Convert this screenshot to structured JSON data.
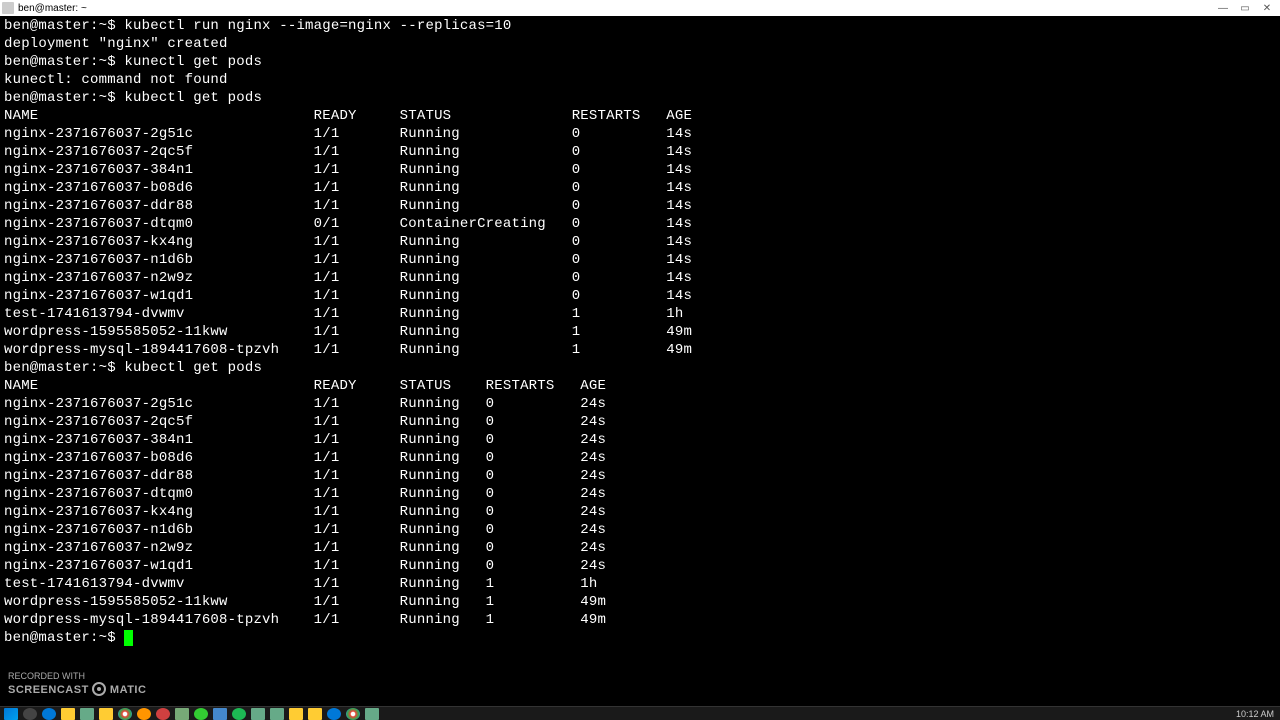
{
  "window": {
    "title": "ben@master: ~"
  },
  "prompt": "ben@master:~$ ",
  "commands": {
    "run_nginx": "kubectl run nginx --image=nginx --replicas=10",
    "run_output": "deployment \"nginx\" created",
    "typo_cmd": "kunectl get pods",
    "typo_output": "kunectl: command not found",
    "get_pods": "kubectl get pods"
  },
  "headers1": [
    "NAME",
    "READY",
    "STATUS",
    "RESTARTS",
    "AGE"
  ],
  "cols1": [
    36,
    10,
    20,
    11,
    6
  ],
  "pods1": [
    [
      "nginx-2371676037-2g51c",
      "1/1",
      "Running",
      "0",
      "14s"
    ],
    [
      "nginx-2371676037-2qc5f",
      "1/1",
      "Running",
      "0",
      "14s"
    ],
    [
      "nginx-2371676037-384n1",
      "1/1",
      "Running",
      "0",
      "14s"
    ],
    [
      "nginx-2371676037-b08d6",
      "1/1",
      "Running",
      "0",
      "14s"
    ],
    [
      "nginx-2371676037-ddr88",
      "1/1",
      "Running",
      "0",
      "14s"
    ],
    [
      "nginx-2371676037-dtqm0",
      "0/1",
      "ContainerCreating",
      "0",
      "14s"
    ],
    [
      "nginx-2371676037-kx4ng",
      "1/1",
      "Running",
      "0",
      "14s"
    ],
    [
      "nginx-2371676037-n1d6b",
      "1/1",
      "Running",
      "0",
      "14s"
    ],
    [
      "nginx-2371676037-n2w9z",
      "1/1",
      "Running",
      "0",
      "14s"
    ],
    [
      "nginx-2371676037-w1qd1",
      "1/1",
      "Running",
      "0",
      "14s"
    ],
    [
      "test-1741613794-dvwmv",
      "1/1",
      "Running",
      "1",
      "1h"
    ],
    [
      "wordpress-1595585052-11kww",
      "1/1",
      "Running",
      "1",
      "49m"
    ],
    [
      "wordpress-mysql-1894417608-tpzvh",
      "1/1",
      "Running",
      "1",
      "49m"
    ]
  ],
  "headers2": [
    "NAME",
    "READY",
    "STATUS",
    "RESTARTS",
    "AGE"
  ],
  "cols2": [
    36,
    10,
    10,
    11,
    6
  ],
  "pods2": [
    [
      "nginx-2371676037-2g51c",
      "1/1",
      "Running",
      "0",
      "24s"
    ],
    [
      "nginx-2371676037-2qc5f",
      "1/1",
      "Running",
      "0",
      "24s"
    ],
    [
      "nginx-2371676037-384n1",
      "1/1",
      "Running",
      "0",
      "24s"
    ],
    [
      "nginx-2371676037-b08d6",
      "1/1",
      "Running",
      "0",
      "24s"
    ],
    [
      "nginx-2371676037-ddr88",
      "1/1",
      "Running",
      "0",
      "24s"
    ],
    [
      "nginx-2371676037-dtqm0",
      "1/1",
      "Running",
      "0",
      "24s"
    ],
    [
      "nginx-2371676037-kx4ng",
      "1/1",
      "Running",
      "0",
      "24s"
    ],
    [
      "nginx-2371676037-n1d6b",
      "1/1",
      "Running",
      "0",
      "24s"
    ],
    [
      "nginx-2371676037-n2w9z",
      "1/1",
      "Running",
      "0",
      "24s"
    ],
    [
      "nginx-2371676037-w1qd1",
      "1/1",
      "Running",
      "0",
      "24s"
    ],
    [
      "test-1741613794-dvwmv",
      "1/1",
      "Running",
      "1",
      "1h"
    ],
    [
      "wordpress-1595585052-11kww",
      "1/1",
      "Running",
      "1",
      "49m"
    ],
    [
      "wordpress-mysql-1894417608-tpzvh",
      "1/1",
      "Running",
      "1",
      "49m"
    ]
  ],
  "watermark": {
    "line1": "RECORDED WITH",
    "line2pre": "SCREENCAST",
    "line2post": "MATIC"
  },
  "clock": "10:12 AM"
}
